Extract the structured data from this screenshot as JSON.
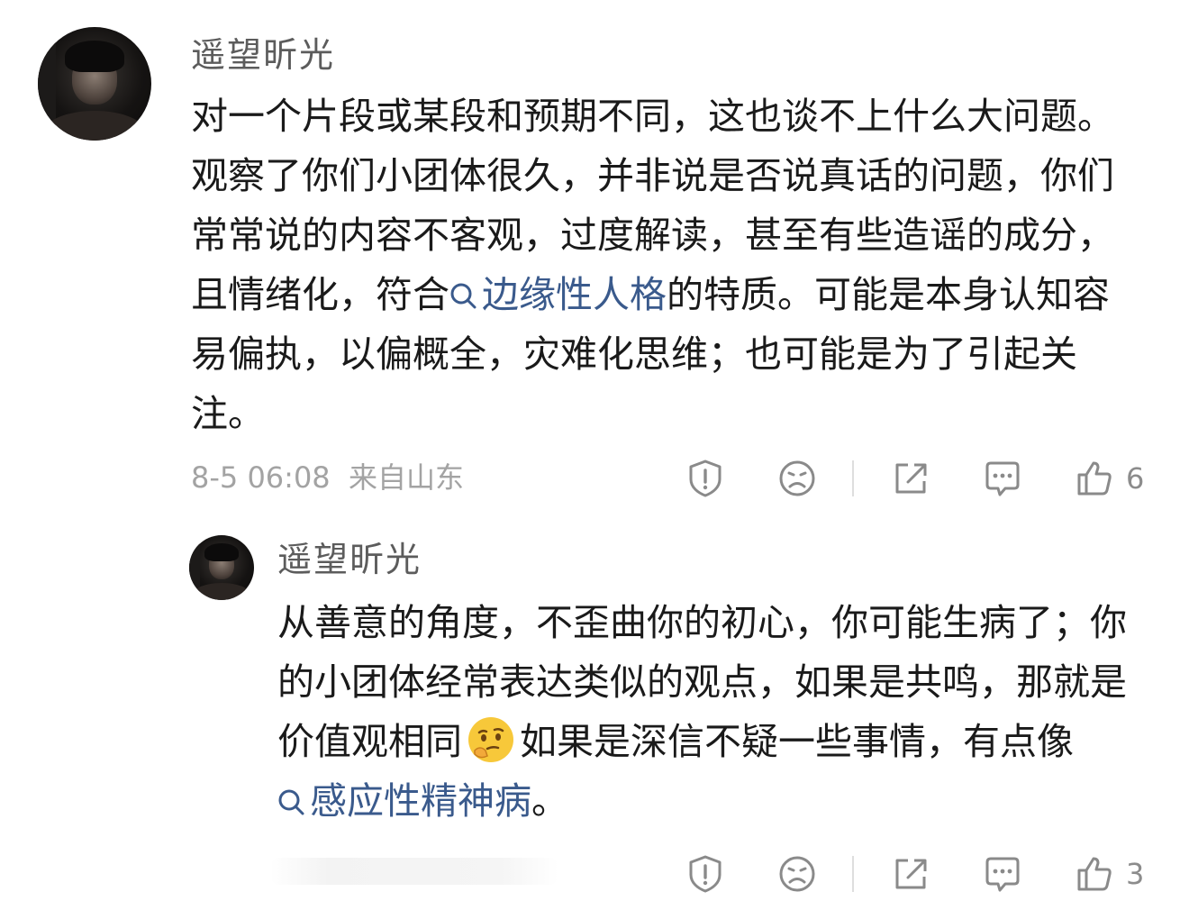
{
  "comment": {
    "username": "遥望昕光",
    "text_before_topic": "对一个片段或某段和预期不同，这也谈不上什么大问题。观察了你们小团体很久，并非说是否说真话的问题，你们常常说的内容不客观，过度解读，甚至有些造谣的成分，且情绪化，符合",
    "topic": "边缘性人格",
    "text_after_topic": "的特质。可能是本身认知容易偏执，以偏概全，灾难化思维；也可能是为了引起关注。",
    "timestamp": "8-5 06:08",
    "location": "来自山东",
    "like_count": "6",
    "icons": [
      "report-icon",
      "dislike-face-icon",
      "share-icon",
      "comment-icon",
      "like-icon"
    ]
  },
  "reply": {
    "username": "遥望昕光",
    "text_before_emoji": "从善意的角度，不歪曲你的初心，你可能生病了；你的小团体经常表达类似的观点，如果是共鸣，那就是价值观相同",
    "emoji": "thinking-face-emoji",
    "text_after_emoji": "如果是深信不疑一些事情，有点像",
    "topic": "感应性精神病",
    "text_end": "。",
    "like_count": "3",
    "icons": [
      "report-icon",
      "dislike-face-icon",
      "share-icon",
      "comment-icon",
      "like-icon"
    ]
  },
  "colors": {
    "topic_link": "#3a5a8c",
    "meta_gray": "#a3a3a3",
    "username_gray": "#5c5c5c"
  }
}
